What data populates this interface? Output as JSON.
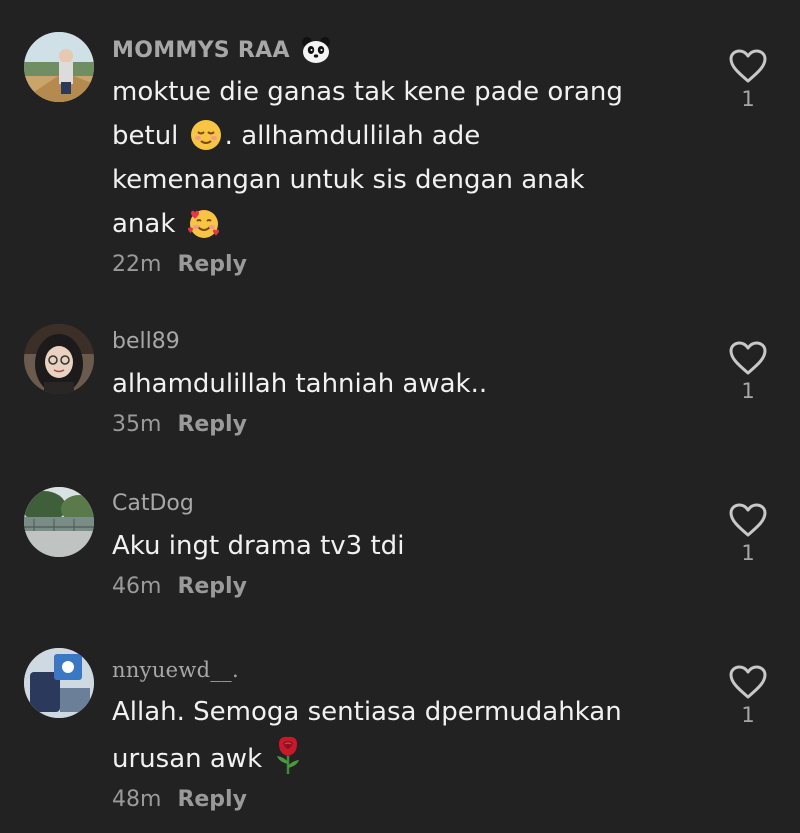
{
  "comments": [
    {
      "username": "MOMMYS RAA",
      "lines": [
        "moktue die ganas tak kene pade orang",
        "betul",
        ". allhamdullilah ade",
        "kemenangan untuk sis dengan anak",
        "anak"
      ],
      "time": "22m",
      "reply": "Reply",
      "likes": "1",
      "icons": [
        "panda-emoji",
        "relieved-face-emoji",
        "smiling-face-with-hearts-emoji"
      ]
    },
    {
      "username": "bell89",
      "lines": [
        "alhamdulillah tahniah awak.."
      ],
      "time": "35m",
      "reply": "Reply",
      "likes": "1"
    },
    {
      "username": "CatDog",
      "lines": [
        "Aku ingt drama tv3 tdi"
      ],
      "time": "46m",
      "reply": "Reply",
      "likes": "1"
    },
    {
      "username": "nnyuewd__.",
      "lines": [
        "Allah. Semoga sentiasa dpermudahkan",
        "urusan awk"
      ],
      "time": "48m",
      "reply": "Reply",
      "likes": "1",
      "icons": [
        "rose-emoji"
      ]
    }
  ],
  "colors": {
    "background": "#222222",
    "text": "#f1f1f1",
    "muted": "#9a9a9a"
  }
}
